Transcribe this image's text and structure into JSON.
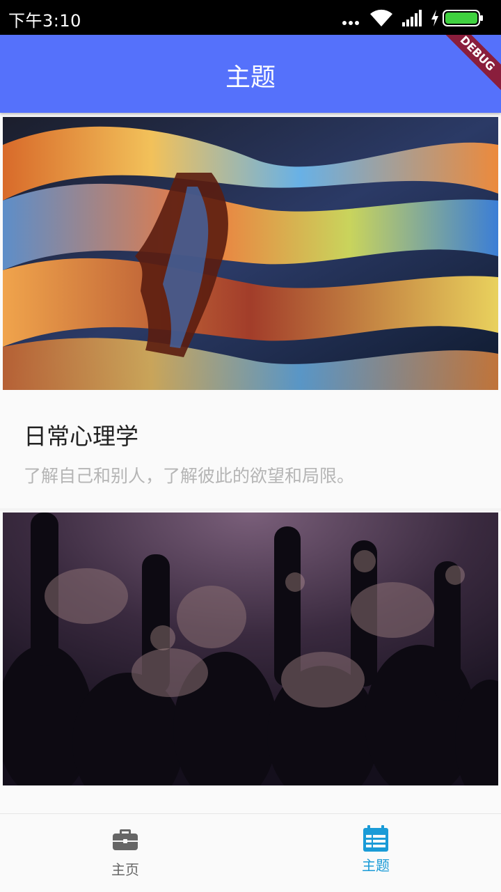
{
  "status_bar": {
    "time": "下午3:10",
    "icons": [
      "more-dots-icon",
      "wifi-icon",
      "signal-icon",
      "charging-icon",
      "battery-icon"
    ]
  },
  "app_bar": {
    "title": "主题",
    "debug_banner": "DEBUG",
    "background": "#5571fb"
  },
  "cards": [
    {
      "title": "日常心理学",
      "subtitle": "了解自己和别人，了解彼此的欲望和局限。",
      "image": "colorful-swirl-face-profile"
    },
    {
      "title": "",
      "subtitle": "",
      "image": "concert-crowd-raised-hands"
    }
  ],
  "bottom_nav": {
    "items": [
      {
        "label": "主页",
        "icon": "briefcase-icon",
        "active": false
      },
      {
        "label": "主题",
        "icon": "calendar-list-icon",
        "active": true
      }
    ],
    "active_color": "#1a9bd7",
    "inactive_color": "#666666"
  }
}
